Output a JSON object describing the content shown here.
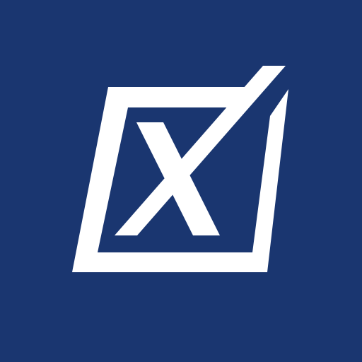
{
  "icon": {
    "name": "checkbox-x-logo-icon",
    "background_color": "#1a3670",
    "foreground_color": "#ffffff"
  }
}
